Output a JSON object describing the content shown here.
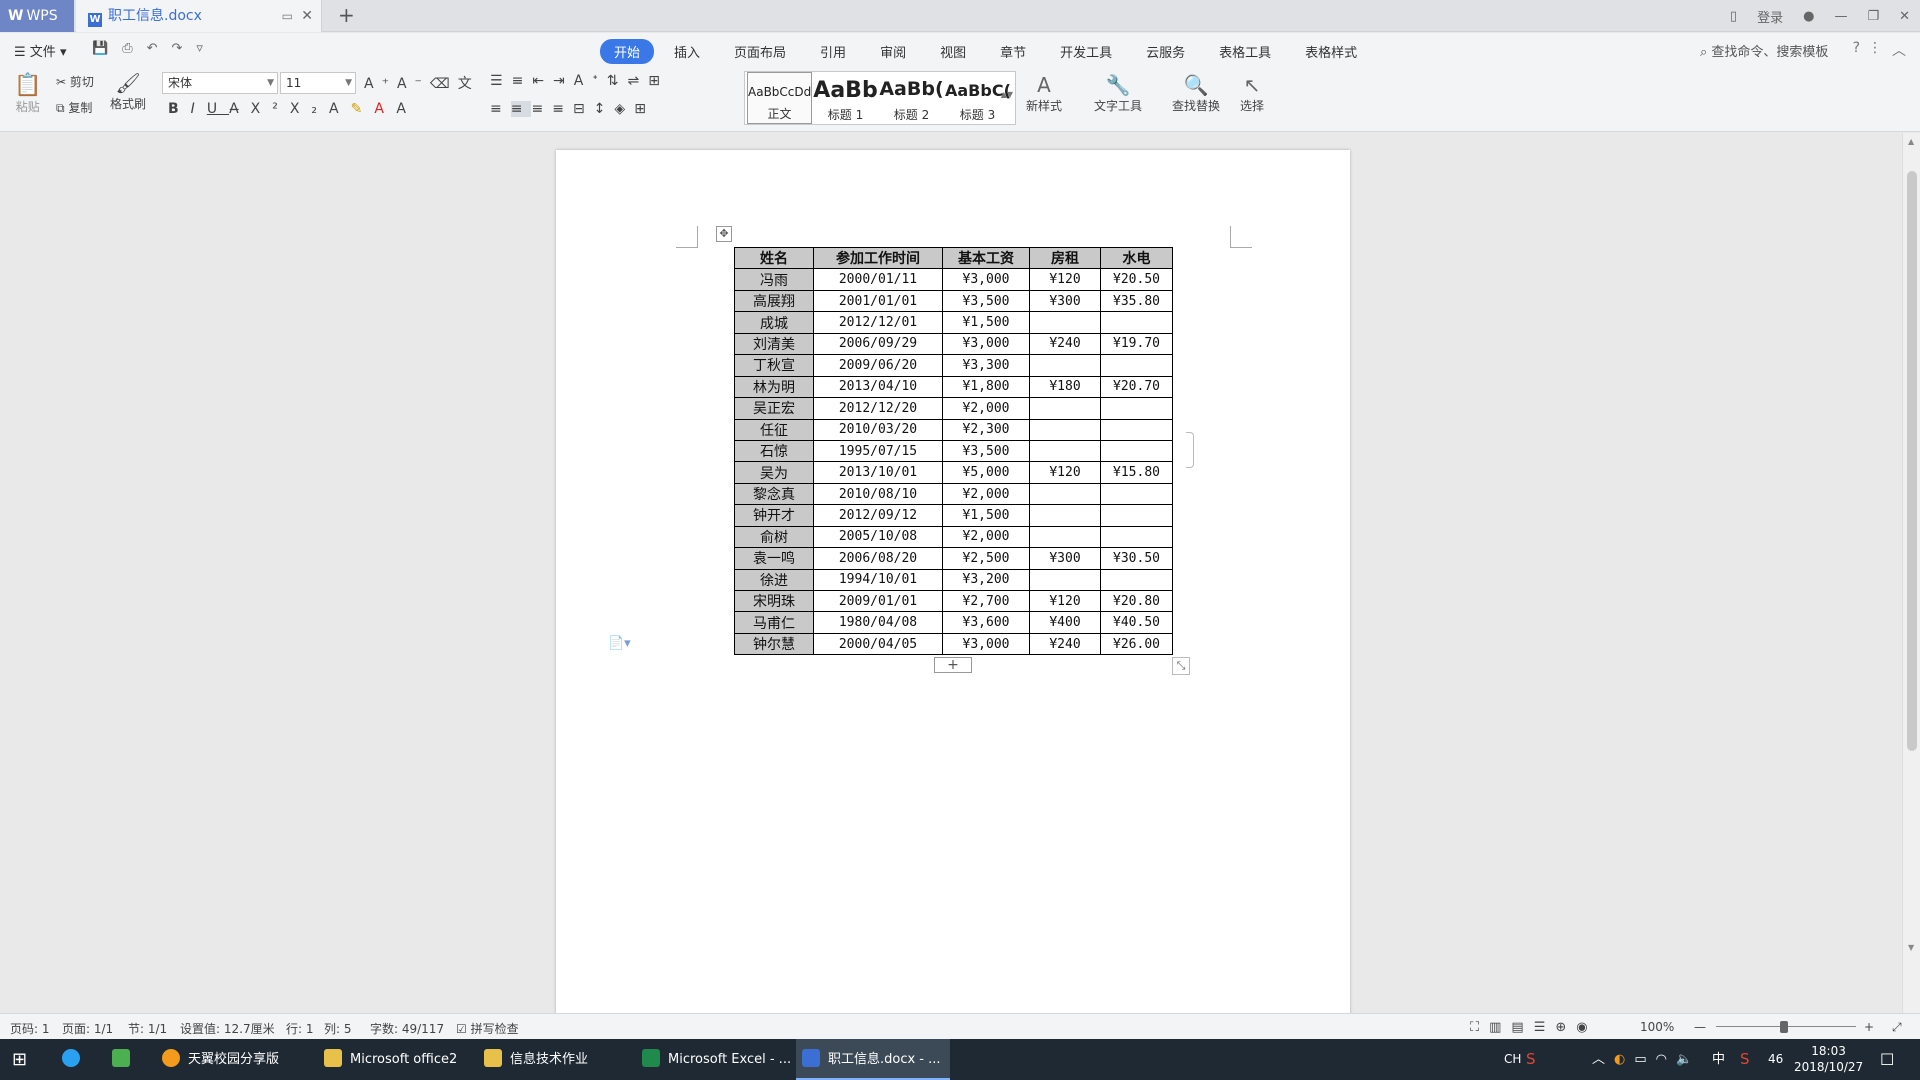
{
  "titlebar": {
    "app_name": "WPS",
    "doc_tab": "职工信息.docx",
    "new_tab": "+",
    "login": "登录"
  },
  "menubar": {
    "file": "文件",
    "tabs": [
      "开始",
      "插入",
      "页面布局",
      "引用",
      "审阅",
      "视图",
      "章节",
      "开发工具",
      "云服务",
      "表格工具",
      "表格样式"
    ],
    "active_tab": "开始",
    "search_placeholder": "查找命令、搜索模板"
  },
  "ribbon": {
    "paste": "粘贴",
    "cut": "剪切",
    "copy": "复制",
    "format_painter": "格式刷",
    "font_name": "宋体",
    "font_size": "11",
    "styles": [
      {
        "preview": "AaBbCcDd",
        "name": "正文"
      },
      {
        "preview": "AaBb",
        "name": "标题 1"
      },
      {
        "preview": "AaBb(",
        "name": "标题 2"
      },
      {
        "preview": "AaBbC(",
        "name": "标题 3"
      }
    ],
    "new_style": "新样式",
    "text_tools": "文字工具",
    "find_replace": "查找替换",
    "select": "选择"
  },
  "table": {
    "headers": [
      "姓名",
      "参加工作时间",
      "基本工资",
      "房租",
      "水电"
    ],
    "rows": [
      [
        "冯雨",
        "2000/01/11",
        "¥3,000",
        "¥120",
        "¥20.50"
      ],
      [
        "高展翔",
        "2001/01/01",
        "¥3,500",
        "¥300",
        "¥35.80"
      ],
      [
        "成城",
        "2012/12/01",
        "¥1,500",
        "",
        ""
      ],
      [
        "刘清美",
        "2006/09/29",
        "¥3,000",
        "¥240",
        "¥19.70"
      ],
      [
        "丁秋宣",
        "2009/06/20",
        "¥3,300",
        "",
        ""
      ],
      [
        "林为明",
        "2013/04/10",
        "¥1,800",
        "¥180",
        "¥20.70"
      ],
      [
        "吴正宏",
        "2012/12/20",
        "¥2,000",
        "",
        ""
      ],
      [
        "任征",
        "2010/03/20",
        "¥2,300",
        "",
        ""
      ],
      [
        "石惊",
        "1995/07/15",
        "¥3,500",
        "",
        ""
      ],
      [
        "吴为",
        "2013/10/01",
        "¥5,000",
        "¥120",
        "¥15.80"
      ],
      [
        "黎念真",
        "2010/08/10",
        "¥2,000",
        "",
        ""
      ],
      [
        "钟开才",
        "2012/09/12",
        "¥1,500",
        "",
        ""
      ],
      [
        "俞树",
        "2005/10/08",
        "¥2,000",
        "",
        ""
      ],
      [
        "袁一鸣",
        "2006/08/20",
        "¥2,500",
        "¥300",
        "¥30.50"
      ],
      [
        "徐进",
        "1994/10/01",
        "¥3,200",
        "",
        ""
      ],
      [
        "宋明珠",
        "2009/01/01",
        "¥2,700",
        "¥120",
        "¥20.80"
      ],
      [
        "马甫仁",
        "1980/04/08",
        "¥3,600",
        "¥400",
        "¥40.50"
      ],
      [
        "钟尔慧",
        "2000/04/05",
        "¥3,000",
        "¥240",
        "¥26.00"
      ]
    ]
  },
  "statusbar": {
    "page_num": "页码: 1",
    "pages": "页面: 1/1",
    "section": "节: 1/1",
    "setting": "设置值: 12.7厘米",
    "row": "行: 1",
    "col": "列: 5",
    "words": "字数: 49/117",
    "spellcheck": "拼写检查",
    "zoom": "100%"
  },
  "taskbar": {
    "items": [
      "天翼校园分享版",
      "Microsoft office2",
      "信息技术作业",
      "Microsoft Excel - ...",
      "职工信息.docx - ..."
    ],
    "tray_ime": "CH",
    "tray_lang": "中",
    "tray_num": "46",
    "time": "18:03",
    "date": "2018/10/27"
  },
  "colors": {
    "accent": "#3b78e7",
    "header_fill": "#c9c9c9",
    "taskbar": "#1f2933"
  }
}
